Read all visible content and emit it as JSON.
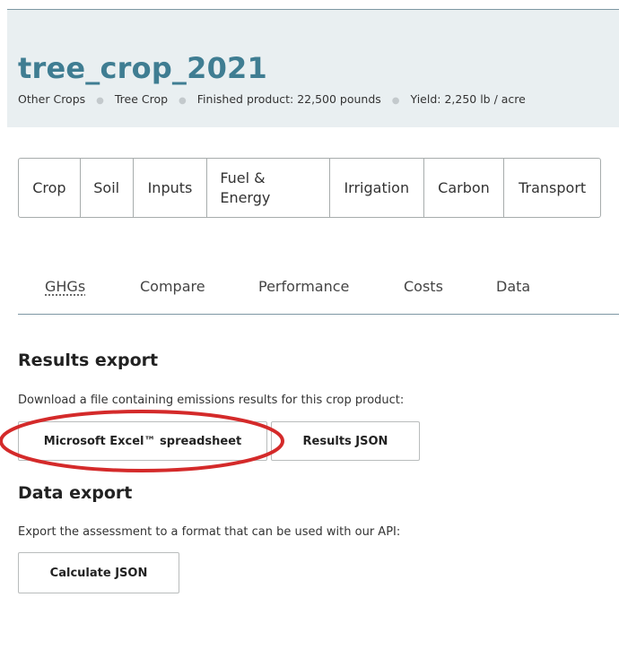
{
  "header": {
    "title": "tree_crop_2021",
    "meta": {
      "crop_category": "Other Crops",
      "crop_type": "Tree Crop",
      "finished_product": "Finished product: 22,500 pounds",
      "yield": "Yield: 2,250 lb / acre"
    }
  },
  "input_tabs": [
    "Crop",
    "Soil",
    "Inputs",
    "Fuel &\nEnergy",
    "Irrigation",
    "Carbon",
    "Transport"
  ],
  "result_tabs": [
    "GHGs",
    "Compare",
    "Performance",
    "Costs",
    "Data"
  ],
  "results_export": {
    "heading": "Results export",
    "description": "Download a file containing emissions results for this crop product:",
    "excel_button": "Microsoft Excel™ spreadsheet",
    "json_button": "Results JSON"
  },
  "data_export": {
    "heading": "Data export",
    "description": "Export the assessment to a format that can be used with our API:",
    "calculate_button": "Calculate JSON"
  },
  "colors": {
    "title": "#3f7d92",
    "header_bg": "#e9eff1",
    "annotation": "#d42a2a"
  }
}
